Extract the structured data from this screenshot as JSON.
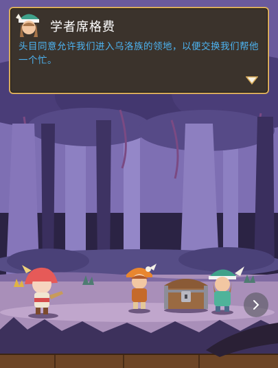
{
  "dialog": {
    "speaker_name": "学者席格费",
    "text": "头目同意允许我们进入乌洛族的领地，以便交换我们帮他一个忙。"
  },
  "icons": {
    "speaker_avatar": "scholar-portrait",
    "advance": "down-triangle",
    "next": "chevron-right"
  },
  "colors": {
    "dialog_bg": "#3b332c",
    "dialog_border": "#d9ad5b",
    "dialog_text": "#4db4f2",
    "speaker_text": "#ffffff"
  }
}
